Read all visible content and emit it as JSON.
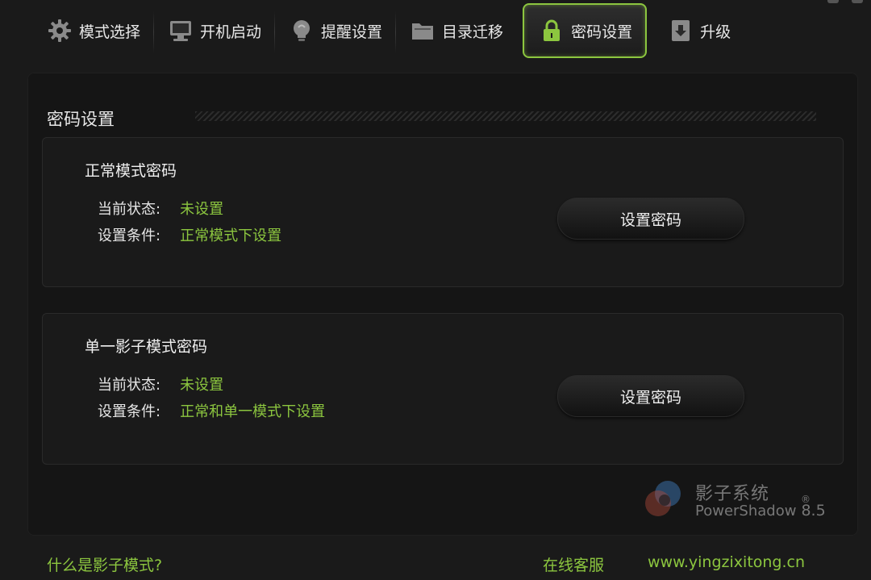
{
  "tabs": [
    {
      "label": "模式选择",
      "icon": "gear-icon"
    },
    {
      "label": "开机启动",
      "icon": "monitor-icon"
    },
    {
      "label": "提醒设置",
      "icon": "lightbulb-icon"
    },
    {
      "label": "目录迁移",
      "icon": "folder-icon"
    },
    {
      "label": "密码设置",
      "icon": "lock-icon",
      "active": true
    },
    {
      "label": "升级",
      "icon": "download-icon"
    }
  ],
  "section": {
    "title": "密码设置"
  },
  "normal_password": {
    "title": "正常模式密码",
    "status_label": "当前状态:",
    "status_value": "未设置",
    "condition_label": "设置条件:",
    "condition_value": "正常模式下设置",
    "button_label": "设置密码"
  },
  "shadow_password": {
    "title": "单一影子模式密码",
    "status_label": "当前状态:",
    "status_value": "未设置",
    "condition_label": "设置条件:",
    "condition_value": "正常和单一模式下设置",
    "button_label": "设置密码"
  },
  "brand": {
    "name_cn": "影子系统",
    "name_en": "PowerShadow",
    "reg": "®",
    "version": "8.5"
  },
  "footer": {
    "what_is_shadow": "什么是影子模式?",
    "online_support": "在线客服",
    "website": "www.yingzixitong.cn"
  },
  "colors": {
    "accent": "#8cc63f",
    "background": "#1a1a1a",
    "panel": "#151515"
  }
}
